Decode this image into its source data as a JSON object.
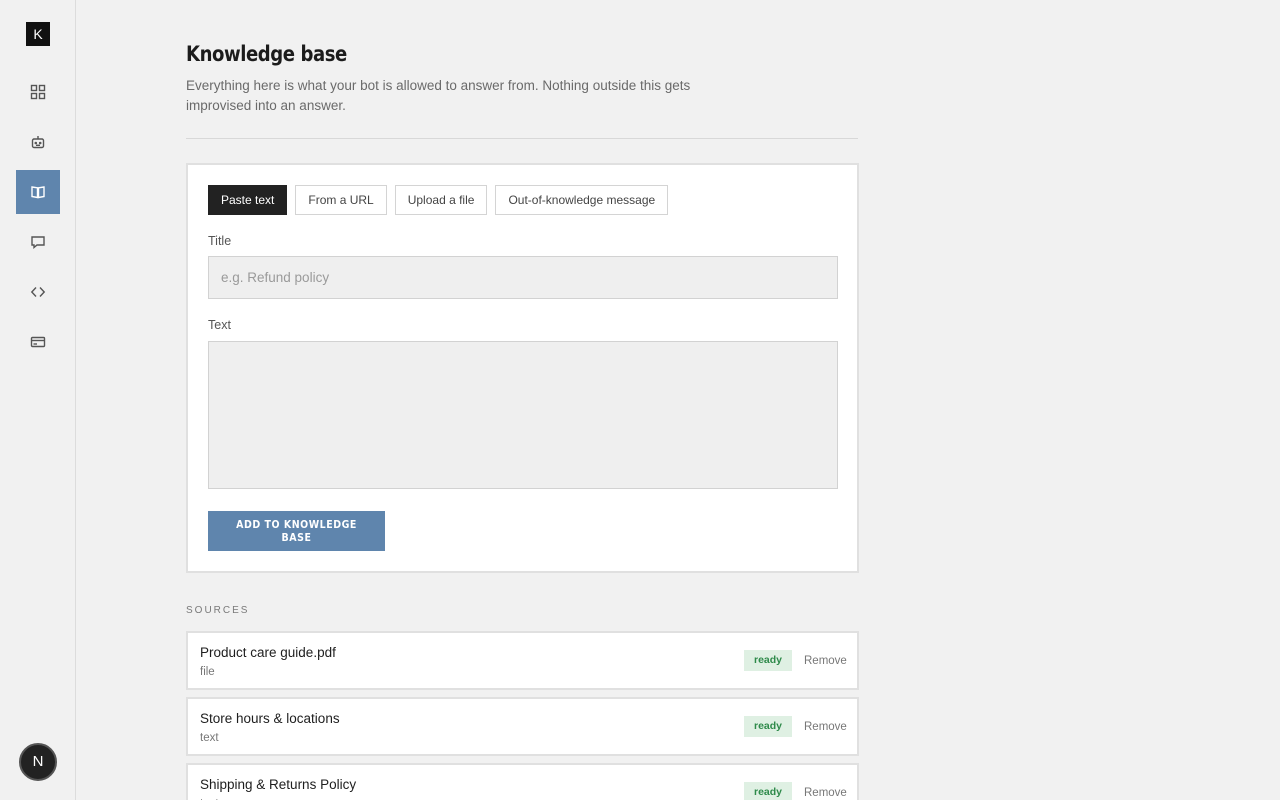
{
  "app": {
    "logo_letter": "K",
    "user_initial": "N"
  },
  "sidebar": {
    "items": [
      {
        "name": "dashboard",
        "icon": "grid-icon"
      },
      {
        "name": "bot",
        "icon": "robot-icon"
      },
      {
        "name": "knowledge",
        "icon": "book-icon",
        "active": true
      },
      {
        "name": "conversations",
        "icon": "chat-icon"
      },
      {
        "name": "embed",
        "icon": "code-icon"
      },
      {
        "name": "billing",
        "icon": "card-icon"
      }
    ]
  },
  "header": {
    "title": "Knowledge base",
    "description": "Everything here is what your bot is allowed to answer from. Nothing outside this gets improvised into an answer."
  },
  "form": {
    "tabs": [
      "Paste text",
      "From a URL",
      "Upload a file",
      "Out-of-knowledge message"
    ],
    "active_tab": 0,
    "title_label": "Title",
    "title_placeholder": "e.g. Refund policy",
    "title_value": "",
    "text_label": "Text",
    "text_value": "",
    "submit_label": "ADD TO KNOWLEDGE BASE"
  },
  "sources": {
    "heading": "SOURCES",
    "items": [
      {
        "name": "Product care guide.pdf",
        "type": "file",
        "status": "ready",
        "action": "Remove"
      },
      {
        "name": "Store hours & locations",
        "type": "text",
        "status": "ready",
        "action": "Remove"
      },
      {
        "name": "Shipping & Returns Policy",
        "type": "text",
        "status": "ready",
        "action": "Remove"
      }
    ]
  },
  "colors": {
    "accent": "#5f85ad",
    "status_ready_bg": "#dff0e3",
    "status_ready_text": "#2e8a4a"
  }
}
